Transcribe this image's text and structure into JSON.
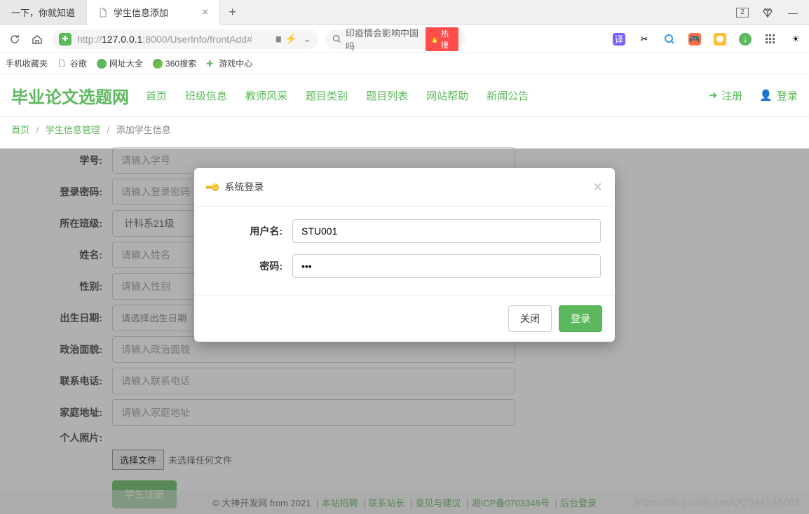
{
  "browser": {
    "tabs": [
      {
        "title": "一下，你就知道"
      },
      {
        "title": "学生信息添加"
      }
    ],
    "window_box": "2",
    "url_prefix": "http://",
    "url_host": "127.0.0.1",
    "url_rest": ":8000/UserInfo/frontAdd#",
    "search_placeholder": "印疫情会影响中国吗",
    "hot_tag": "热搜"
  },
  "bookmarks": [
    "手机收藏夹",
    "谷歌",
    "网址大全",
    "360搜索",
    "游戏中心"
  ],
  "site": {
    "logo": "毕业论文选题网",
    "nav": [
      "首页",
      "班级信息",
      "教师风采",
      "题目类别",
      "题目列表",
      "网站帮助",
      "新闻公告"
    ],
    "register": "注册",
    "login": "登录"
  },
  "breadcrumb": {
    "home": "首页",
    "mgmt": "学生信息管理",
    "current": "添加学生信息"
  },
  "form": {
    "labels": {
      "sno": "学号:",
      "pwd": "登录密码:",
      "class": "所在班级:",
      "name": "姓名:",
      "gender": "性别:",
      "birth": "出生日期:",
      "politics": "政治面貌:",
      "phone": "联系电话:",
      "addr": "家庭地址:",
      "photo": "个人照片:"
    },
    "placeholders": {
      "sno": "请输入学号",
      "pwd": "请输入登录密码",
      "name": "请输入姓名",
      "gender": "请输入性别",
      "birth": "请选择出生日期",
      "politics": "请输入政治面貌",
      "phone": "请输入联系电话",
      "addr": "请输入家庭地址"
    },
    "class_value": "计科系21级",
    "file_btn": "选择文件",
    "file_none": "未选择任何文件",
    "submit": "学生注册"
  },
  "modal": {
    "title": "系统登录",
    "user_label": "用户名:",
    "user_value": "STU001",
    "pwd_label": "密码:",
    "pwd_value": "•••",
    "close_btn": "关闭",
    "login_btn": "登录"
  },
  "footer": {
    "copyright": "© 大神开发网 from 2021",
    "links": [
      "本站招聘",
      "联系站长",
      "意见与建议",
      "湘ICP备0703346号",
      "后台登录"
    ]
  },
  "watermark": "https://blog.csdn.net/QQ344245001"
}
